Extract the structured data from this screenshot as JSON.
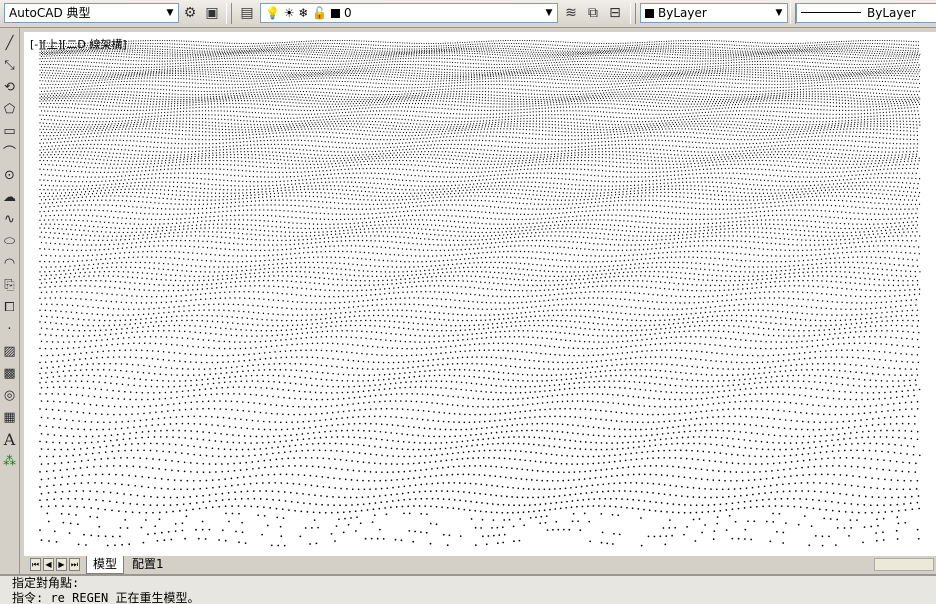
{
  "toolbar": {
    "workspace": "AutoCAD 典型",
    "layer_name": "0",
    "color": "ByLayer",
    "linetype": "ByLayer",
    "icons": [
      "gear-icon",
      "workspace-toggle-icon",
      "layer-properties-icon",
      "lightbulb-icon",
      "sun-icon",
      "freeze-icon",
      "lock-icon",
      "layer-state-icon",
      "match-layer-icon",
      "previous-layer-icon"
    ]
  },
  "left_toolbar": {
    "icons": [
      "line-icon",
      "construction-line-icon",
      "polyline-icon",
      "polygon-icon",
      "rectangle-icon",
      "arc-icon",
      "circle-icon",
      "revision-cloud-icon",
      "spline-icon",
      "ellipse-icon",
      "ellipse-arc-icon",
      "insert-block-icon",
      "make-block-icon",
      "point-icon",
      "hatch-icon",
      "gradient-icon",
      "region-icon",
      "table-icon",
      "multiline-text-icon",
      "add-selected-icon"
    ],
    "text_icon_label": "A"
  },
  "viewport": {
    "label": "[-][上][二D 線架構]"
  },
  "tabs": {
    "items": [
      {
        "label": "模型",
        "active": true
      },
      {
        "label": "配置1",
        "active": false
      }
    ]
  },
  "command_line": {
    "line1": "指定對角點:",
    "line2": "指令: re REGEN 正在重生模型。"
  },
  "colors": {
    "toolbar_bg": "#d4d0c8",
    "canvas_bg": "#ffffff",
    "dots": "#000000"
  }
}
